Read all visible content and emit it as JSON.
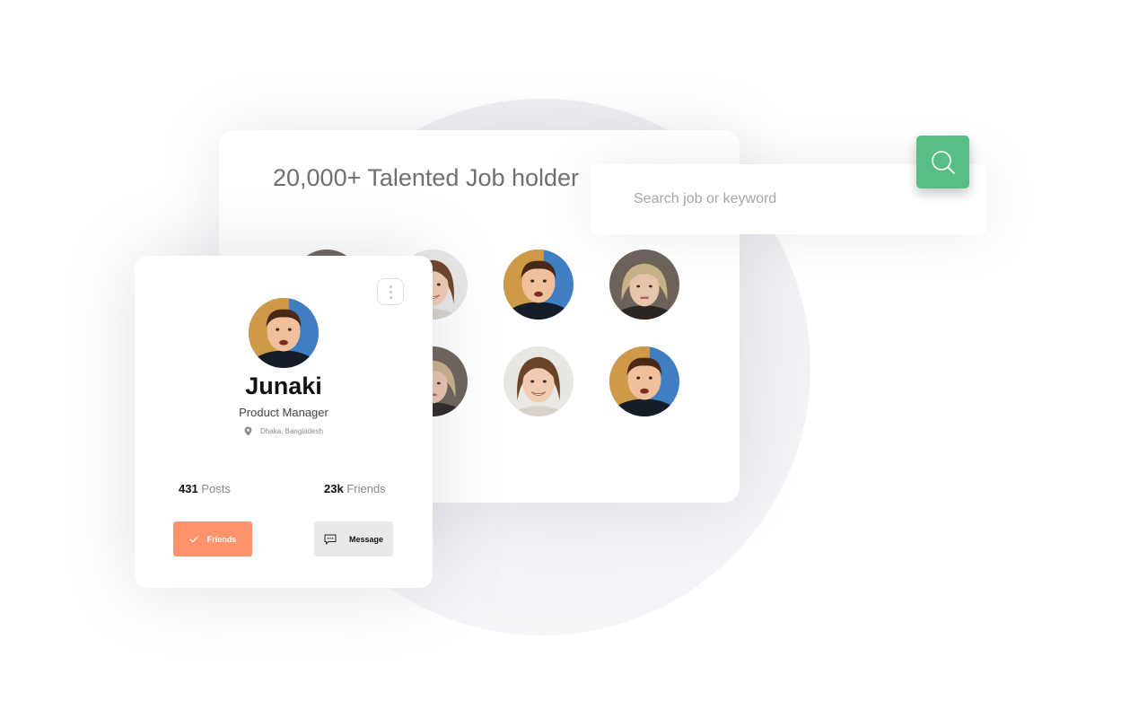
{
  "main_card": {
    "title": "20,000+ Talented Job holder"
  },
  "search": {
    "placeholder": "Search job or keyword"
  },
  "profile": {
    "name": "Junaki",
    "role": "Product Manager",
    "location": "Dhaka, Bangladesh",
    "posts_count": "431",
    "posts_label": "Posts",
    "friends_count": "23k",
    "friends_label": "Friends",
    "friends_button_label": "Friends",
    "message_button_label": "Message"
  },
  "colors": {
    "search_button": "#58bf84",
    "friends_button": "#ff936b",
    "message_button": "#e8e8e8"
  },
  "icons": {
    "search_button": "search-icon",
    "menu": "kebab-menu-icon",
    "location": "map-pin-icon",
    "friends_button": "check-icon",
    "message_button": "chat-bubble-icon"
  }
}
